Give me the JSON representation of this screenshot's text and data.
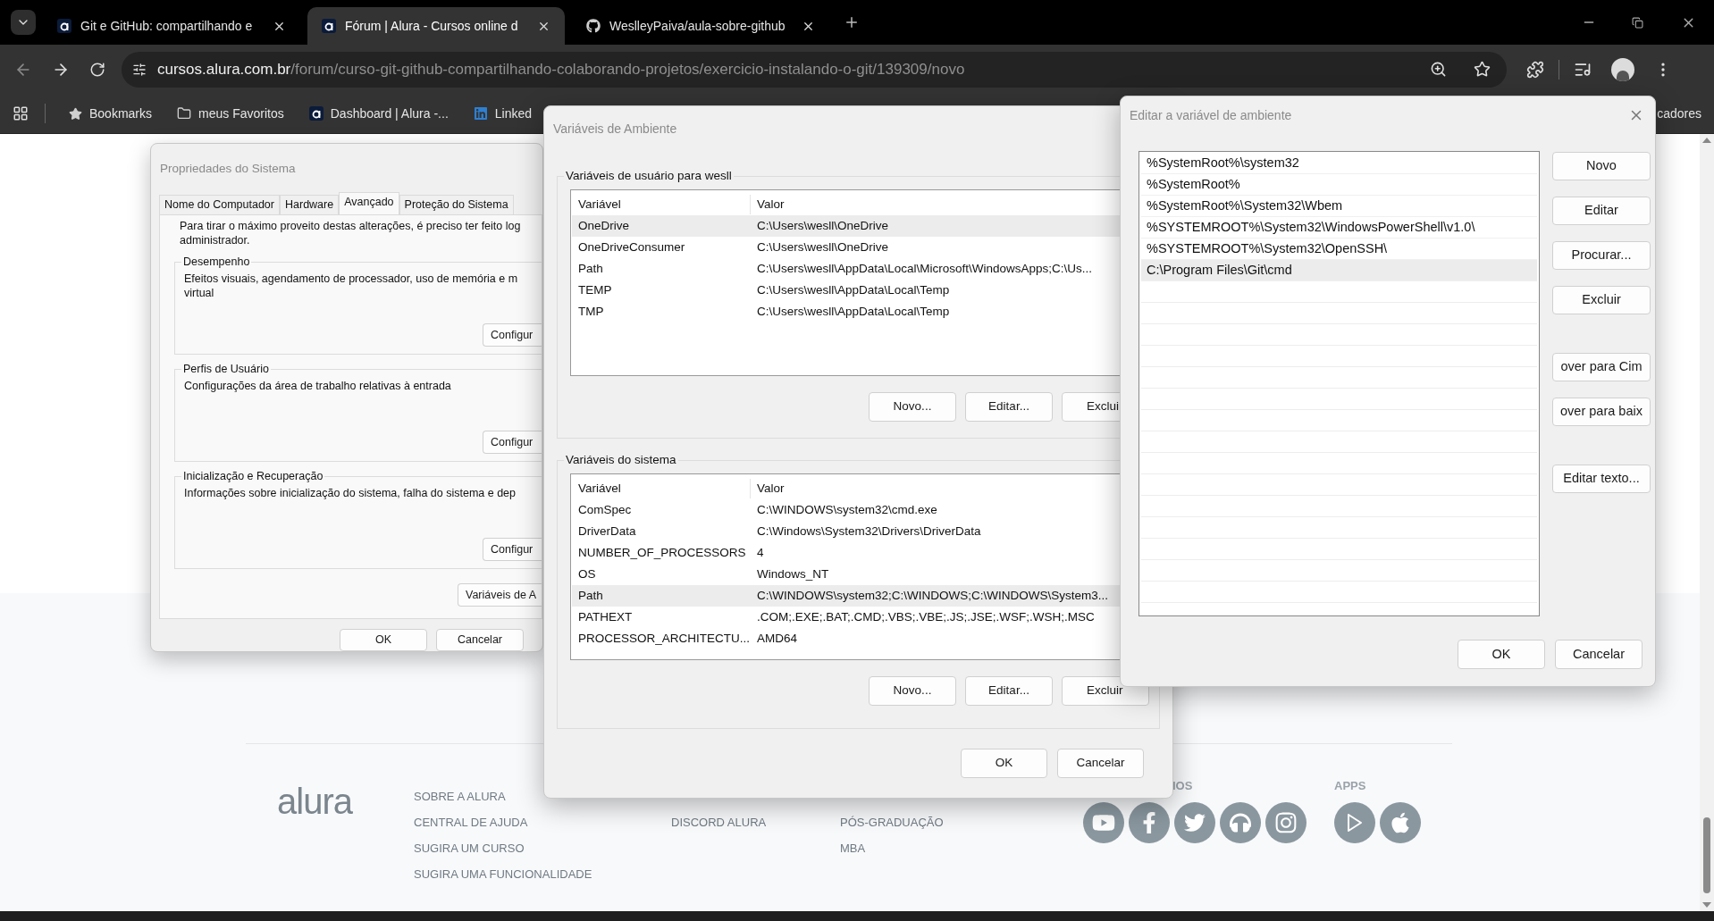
{
  "browser": {
    "tabs": [
      {
        "title": "Git e GitHub: compartilhando e",
        "kind": "alura",
        "selected": false
      },
      {
        "title": "Fórum | Alura - Cursos online d",
        "kind": "alura",
        "selected": true
      },
      {
        "title": "WeslleyPaiva/aula-sobre-github",
        "kind": "github",
        "selected": false
      }
    ],
    "url": {
      "host": "cursos.alura.com.br",
      "path": "/forum/curso-git-github-compartilhando-colaborando-projetos/exercicio-instalando-o-git/139309/novo"
    },
    "bookmarks": [
      {
        "label": "Bookmarks",
        "kind": "star"
      },
      {
        "label": "meus Favoritos",
        "kind": "folder"
      },
      {
        "label": "Dashboard | Alura -...",
        "kind": "alura"
      },
      {
        "label": "Linked",
        "kind": "linkedin"
      }
    ],
    "bookmarks_overflow": "cadores"
  },
  "footer": {
    "columns": [
      [
        "SOBRE A ALURA",
        "CENTRAL DE AJUDA",
        "SUGIRA UM CURSO",
        "SUGIRA UMA FUNCIONALIDADE"
      ],
      [
        "DISCORD ALURA"
      ],
      [
        "PÓS-GRADUAÇÃO",
        "MBA"
      ]
    ],
    "social": {
      "heading": "IOS",
      "icons": [
        {
          "kind": "youtube"
        },
        {
          "kind": "facebook"
        },
        {
          "kind": "twitter"
        },
        {
          "kind": "headphones"
        },
        {
          "kind": "instagram"
        }
      ]
    },
    "apps": {
      "heading": "APPS",
      "icons": [
        {
          "kind": "play"
        },
        {
          "kind": "apple"
        }
      ]
    }
  },
  "system_properties": {
    "title": "Propriedades do Sistema",
    "tabs": [
      {
        "label": "Nome do Computador",
        "selected": false
      },
      {
        "label": "Hardware",
        "selected": false
      },
      {
        "label": "Avançado",
        "selected": true
      },
      {
        "label": "Proteção do Sistema",
        "selected": false
      }
    ],
    "intro": [
      "Para tirar o máximo proveito destas alterações, é preciso ter feito log",
      "administrador."
    ],
    "groups": [
      {
        "title": "Desempenho",
        "lines": [
          "Efeitos visuais, agendamento de processador, uso de memória e m",
          "virtual"
        ],
        "button": "Configur"
      },
      {
        "title": "Perfis de Usuário",
        "lines": [
          "Configurações da área de trabalho relativas à entrada"
        ],
        "button": "Configur"
      },
      {
        "title": "Inicialização e Recuperação",
        "lines": [
          "Informações sobre inicialização do sistema, falha do sistema e dep"
        ],
        "button": "Configur"
      }
    ],
    "env_button": "Variáveis de A",
    "buttons": [
      "OK",
      "Cancelar"
    ]
  },
  "environment": {
    "title": "Variáveis de Ambiente",
    "user": {
      "title": "Variáveis de usuário para wesll",
      "columns": [
        "Variável",
        "Valor"
      ],
      "rows": [
        {
          "name": "OneDrive",
          "value": "C:\\Users\\wesll\\OneDrive",
          "selected": true
        },
        {
          "name": "OneDriveConsumer",
          "value": "C:\\Users\\wesll\\OneDrive",
          "selected": false
        },
        {
          "name": "Path",
          "value": "C:\\Users\\wesll\\AppData\\Local\\Microsoft\\WindowsApps;C:\\Us...",
          "selected": false
        },
        {
          "name": "TEMP",
          "value": "C:\\Users\\wesll\\AppData\\Local\\Temp",
          "selected": false
        },
        {
          "name": "TMP",
          "value": "C:\\Users\\wesll\\AppData\\Local\\Temp",
          "selected": false
        }
      ],
      "buttons": [
        "Novo...",
        "Editar...",
        "Exclui"
      ]
    },
    "system": {
      "title": "Variáveis do sistema",
      "columns": [
        "Variável",
        "Valor"
      ],
      "rows": [
        {
          "name": "ComSpec",
          "value": "C:\\WINDOWS\\system32\\cmd.exe",
          "selected": false
        },
        {
          "name": "DriverData",
          "value": "C:\\Windows\\System32\\Drivers\\DriverData",
          "selected": false
        },
        {
          "name": "NUMBER_OF_PROCESSORS",
          "value": "4",
          "selected": false
        },
        {
          "name": "OS",
          "value": "Windows_NT",
          "selected": false
        },
        {
          "name": "Path",
          "value": "C:\\WINDOWS\\system32;C:\\WINDOWS;C:\\WINDOWS\\System3...",
          "selected": true
        },
        {
          "name": "PATHEXT",
          "value": ".COM;.EXE;.BAT;.CMD;.VBS;.VBE;.JS;.JSE;.WSF;.WSH;.MSC",
          "selected": false
        },
        {
          "name": "PROCESSOR_ARCHITECTU...",
          "value": "AMD64",
          "selected": false
        }
      ],
      "buttons": [
        "Novo...",
        "Editar...",
        "Excluir"
      ]
    },
    "buttons": [
      "OK",
      "Cancelar"
    ]
  },
  "edit_variable": {
    "title": "Editar a variável de ambiente",
    "entries": [
      {
        "text": "%SystemRoot%\\system32",
        "selected": false
      },
      {
        "text": "%SystemRoot%",
        "selected": false
      },
      {
        "text": "%SystemRoot%\\System32\\Wbem",
        "selected": false
      },
      {
        "text": "%SYSTEMROOT%\\System32\\WindowsPowerShell\\v1.0\\",
        "selected": false
      },
      {
        "text": "%SYSTEMROOT%\\System32\\OpenSSH\\",
        "selected": false
      },
      {
        "text": "C:\\Program Files\\Git\\cmd",
        "selected": true
      }
    ],
    "side_buttons": [
      [
        "Novo",
        "Editar",
        "Procurar...",
        "Excluir"
      ],
      [
        "over para Cim",
        "over para baix"
      ],
      [
        "Editar texto..."
      ]
    ],
    "buttons": [
      "OK",
      "Cancelar"
    ]
  }
}
